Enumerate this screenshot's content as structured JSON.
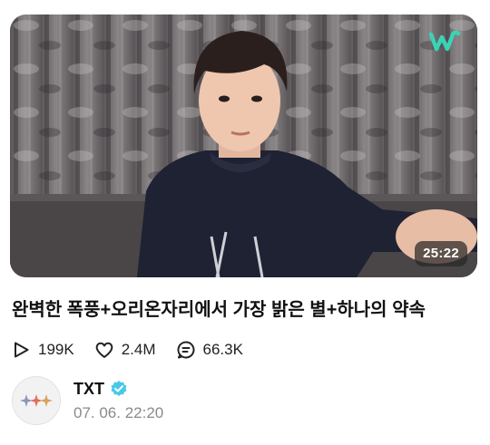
{
  "video": {
    "duration": "25:22",
    "title": "완벽한 폭풍+오리온자리에서 가장 밝은 별+하나의 약속",
    "brand_icon": "weverse-logo-icon"
  },
  "stats": {
    "views": "199K",
    "likes": "2.4M",
    "comments": "66.3K"
  },
  "author": {
    "name": "TXT",
    "date": "07. 06. 22:20",
    "verified": true
  },
  "colors": {
    "brand": "#3ad3b6",
    "verified": "#49c8e8",
    "text": "#111111",
    "muted": "#8a8a8a"
  }
}
